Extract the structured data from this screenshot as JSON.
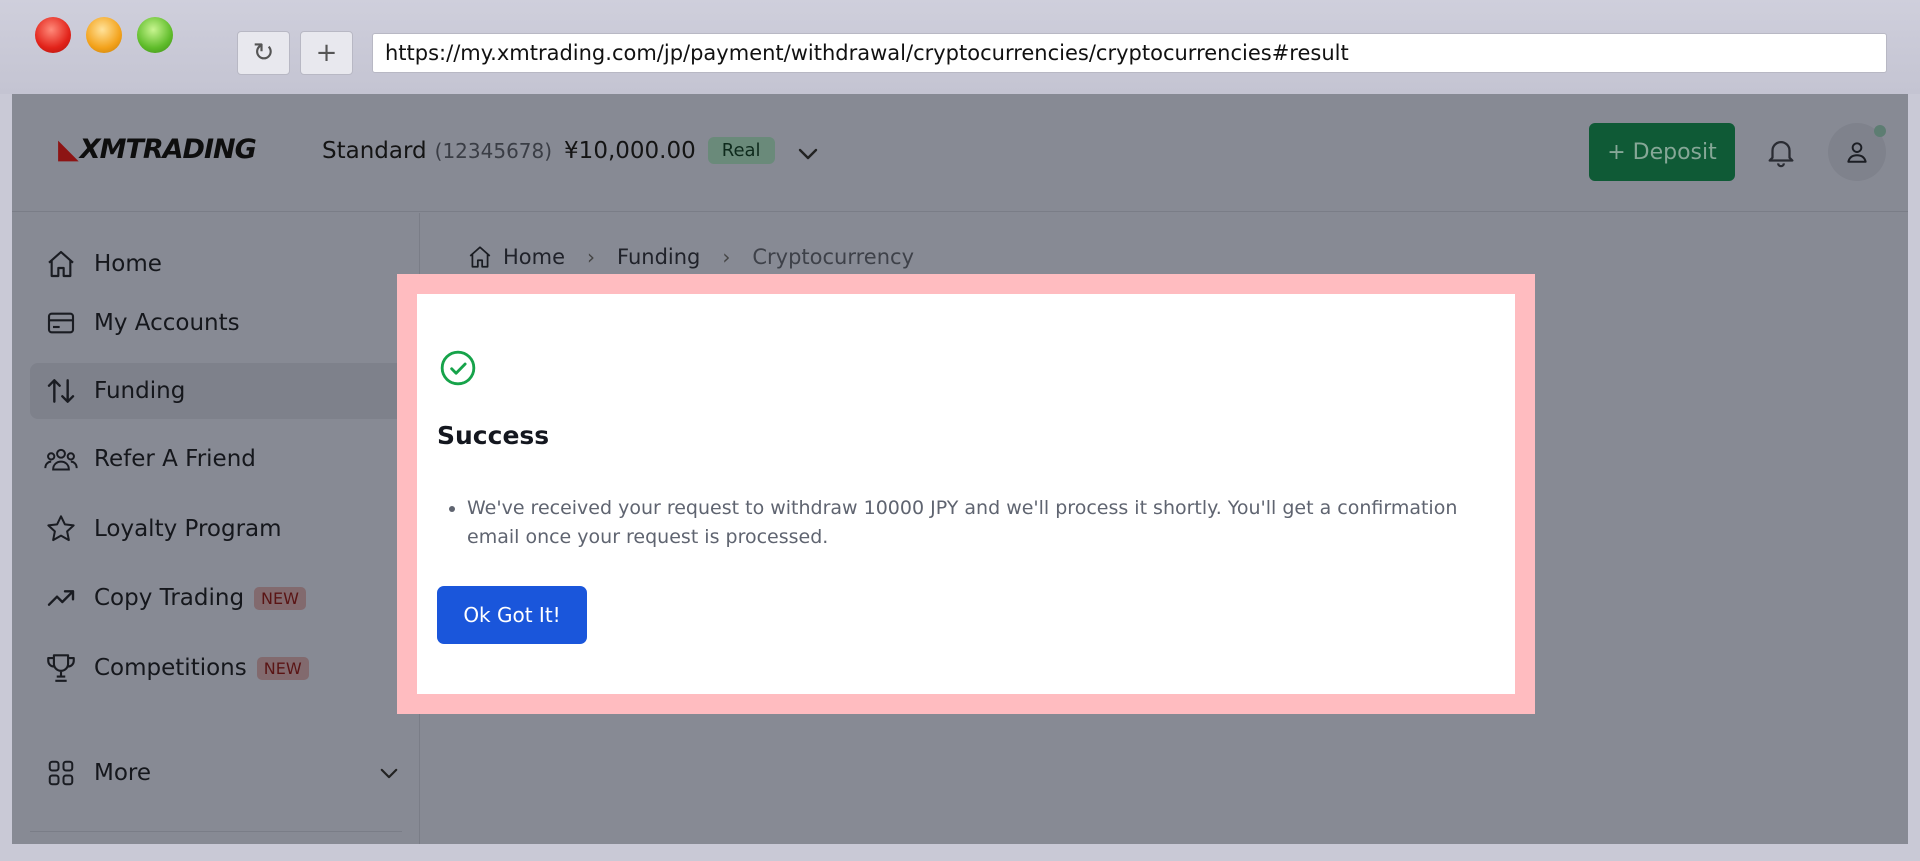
{
  "browser": {
    "url": "https://my.xmtrading.com/jp/payment/withdrawal/cryptocurrencies/cryptocurrencies#result",
    "reload_glyph": "↻",
    "newtab_glyph": "+"
  },
  "header": {
    "logo_text": "XMTRADING",
    "account_type": "Standard",
    "account_number": "(12345678)",
    "balance": "¥10,000.00",
    "account_badge": "Real",
    "deposit_label": "+ Deposit"
  },
  "breadcrumb": {
    "items": [
      "Home",
      "Funding",
      "Cryptocurrency"
    ]
  },
  "sidebar": {
    "items": [
      {
        "label": "Home",
        "icon": "home-icon"
      },
      {
        "label": "My Accounts",
        "icon": "card-icon"
      },
      {
        "label": "Funding",
        "icon": "transfer-icon",
        "active": true
      },
      {
        "label": "Refer A Friend",
        "icon": "users-icon"
      },
      {
        "label": "Loyalty Program",
        "icon": "star-icon"
      },
      {
        "label": "Copy Trading",
        "icon": "trend-icon",
        "badge": "NEW"
      },
      {
        "label": "Competitions",
        "icon": "trophy-icon",
        "badge": "NEW"
      },
      {
        "label": "More",
        "icon": "grid-icon"
      }
    ]
  },
  "modal": {
    "title": "Success",
    "message": "We've received your request to withdraw 10000 JPY and we'll process it shortly. You'll get a confirmation email once your request is processed.",
    "button_label": "Ok Got It!"
  },
  "colors": {
    "accent_blue": "#1a56db",
    "success_green": "#16a34a",
    "highlight": "#ffbcc0"
  }
}
